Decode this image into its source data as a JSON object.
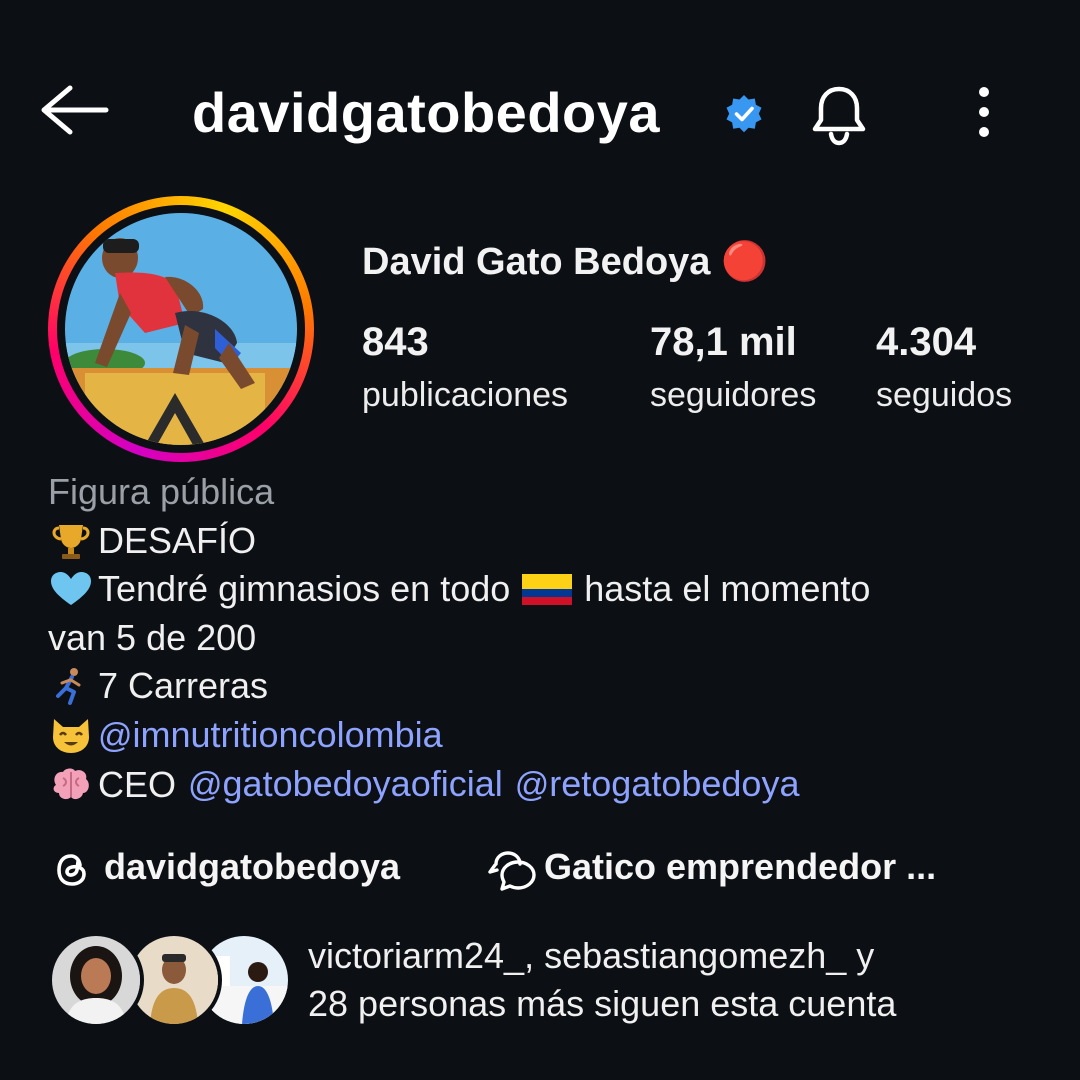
{
  "header": {
    "username": "davidgatobedoya",
    "icons": [
      "back-arrow-icon",
      "verified-badge-icon",
      "bell-icon",
      "more-vertical-icon"
    ]
  },
  "profile": {
    "full_name": "David Gato Bedoya 🔴",
    "stats": [
      {
        "value": "843",
        "label": "publicaciones"
      },
      {
        "value": "78,1 mil",
        "label": "seguidores"
      },
      {
        "value": "4.304",
        "label": "seguidos"
      }
    ]
  },
  "bio": {
    "category": "Figura pública",
    "line1": "DESAFÍO",
    "line2a": "Tendré gimnasios en todo",
    "line2b": "hasta el momento",
    "line3": "van 5 de 200",
    "line4": "7 Carreras",
    "mention1": "imnutritioncolombia",
    "line6_prefix": "CEO",
    "mention2": "gatobedoyaoficial",
    "mention3": "retogatobedoya"
  },
  "links": {
    "threads": "davidgatobedoya",
    "channel": "Gatico emprendedor ..."
  },
  "followed_by": {
    "text_line1": "victoriarm24_, sebastiangomezh_ y",
    "text_line2": "28 personas más siguen esta cuenta"
  },
  "colors": {
    "background": "#0c0f14",
    "verified": "#3897f0",
    "mention": "#8ea3ff",
    "muted": "#9aa0a6"
  }
}
